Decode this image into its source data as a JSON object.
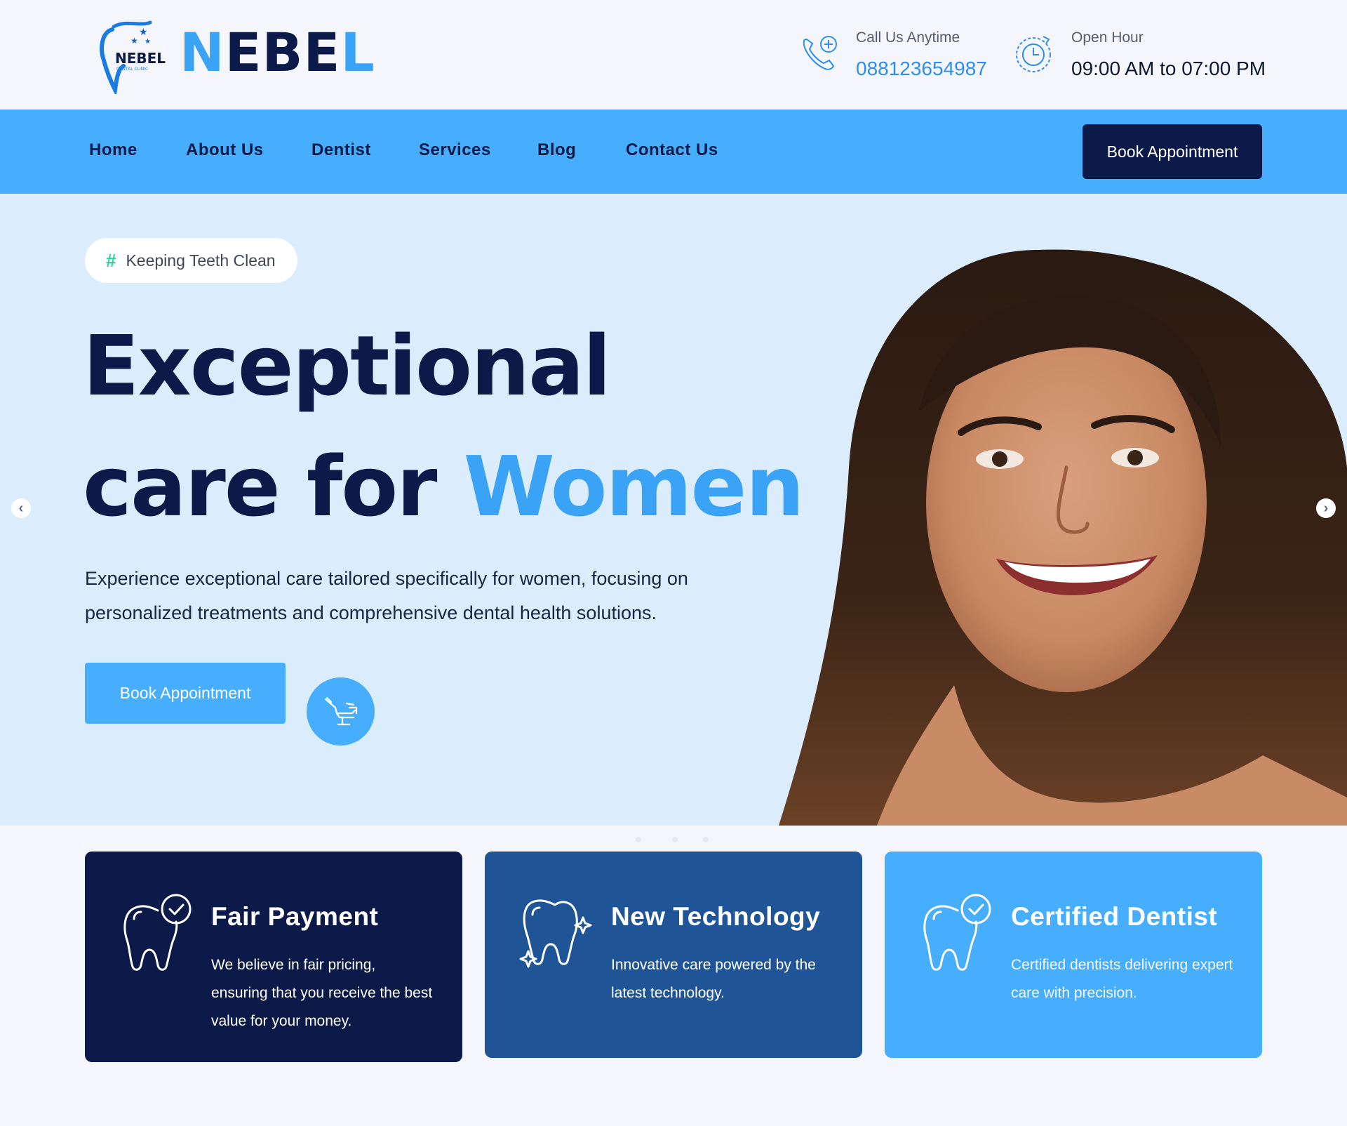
{
  "brand": {
    "name_part1": "N",
    "name_part2": "EBE",
    "name_part3": "L",
    "logo_text": "NEBEL",
    "logo_subtext": "DENTAL CLINIC"
  },
  "header": {
    "phone_label": "Call Us Anytime",
    "phone_value": "088123654987",
    "hours_label": "Open Hour",
    "hours_value": "09:00 AM to 07:00 PM"
  },
  "nav": {
    "items": [
      {
        "label": "Home"
      },
      {
        "label": "About Us"
      },
      {
        "label": "Dentist"
      },
      {
        "label": "Services"
      },
      {
        "label": "Blog"
      },
      {
        "label": "Contact Us"
      }
    ],
    "cta_label": "Book Appointment"
  },
  "hero": {
    "tagline_hash": "#",
    "tagline": "Keeping Teeth Clean",
    "headline_line1": "Exceptional",
    "headline_line2_plain": "care for ",
    "headline_line2_accent": "Women",
    "description": "Experience exceptional care tailored specifically for women, focusing on personalized treatments and comprehensive dental health solutions.",
    "cta_label": "Book Appointment",
    "prev_arrow": "‹",
    "next_arrow": "›",
    "slides_count": 3
  },
  "features": [
    {
      "title": "Fair Payment",
      "text": "We believe in fair pricing, ensuring that you receive the best value for your money.",
      "icon": "tooth-check-icon"
    },
    {
      "title": "New Technology",
      "text": "Innovative care powered by the latest technology.",
      "icon": "tooth-sparkle-icon"
    },
    {
      "title": "Certified Dentist",
      "text": "Certified dentists delivering expert care with precision.",
      "icon": "tooth-check-icon"
    }
  ],
  "colors": {
    "primary": "#47aefe",
    "dark_navy": "#0b1a48",
    "mid_blue": "#1f5597",
    "accent_text": "#3aa3f5",
    "hero_bg": "#dbedfc",
    "tag_hash": "#2bd39a"
  }
}
